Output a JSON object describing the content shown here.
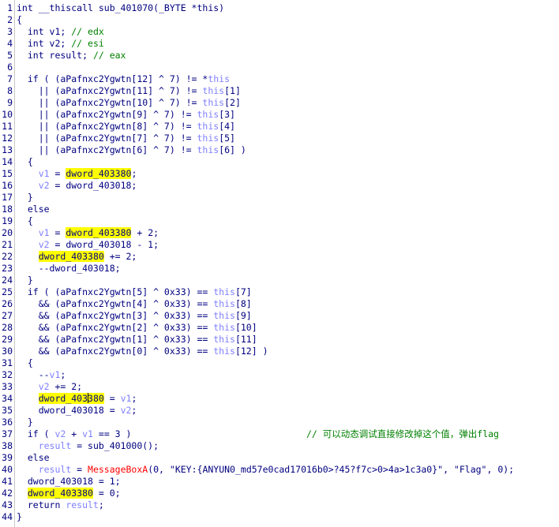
{
  "colors": {
    "background": "#ffffff",
    "text": "#000080",
    "comment": "#008000",
    "this_keyword": "#8080ff",
    "highlight": "#ffff00",
    "api_function": "#ff0000"
  },
  "line_numbers": [
    "1",
    "2",
    "3",
    "4",
    "5",
    "6",
    "7",
    "8",
    "9",
    "10",
    "11",
    "12",
    "13",
    "14",
    "15",
    "16",
    "17",
    "18",
    "19",
    "20",
    "21",
    "22",
    "23",
    "24",
    "25",
    "26",
    "27",
    "28",
    "29",
    "30",
    "31",
    "32",
    "33",
    "34",
    "35",
    "36",
    "37",
    "38",
    "39",
    "40",
    "41",
    "42",
    "43",
    "44"
  ],
  "code": {
    "l1": "int __thiscall sub_401070(_BYTE *this)",
    "l2": "{",
    "l3a": "  int v1; ",
    "l3b": "// edx",
    "l4a": "  int v2; ",
    "l4b": "// esi",
    "l5a": "  int result; ",
    "l5b": "// eax",
    "l6": "",
    "l7a": "  if ( (aPafnxc2Ygwtn[12] ^ 7) != *",
    "l7b": "this",
    "l8a": "    || (aPafnxc2Ygwtn[11] ^ 7) != ",
    "l8b": "this",
    "l8c": "[1]",
    "l9a": "    || (aPafnxc2Ygwtn[10] ^ 7) != ",
    "l9b": "this",
    "l9c": "[2]",
    "l10a": "    || (aPafnxc2Ygwtn[9] ^ 7) != ",
    "l10b": "this",
    "l10c": "[3]",
    "l11a": "    || (aPafnxc2Ygwtn[8] ^ 7) != ",
    "l11b": "this",
    "l11c": "[4]",
    "l12a": "    || (aPafnxc2Ygwtn[7] ^ 7) != ",
    "l12b": "this",
    "l12c": "[5]",
    "l13a": "    || (aPafnxc2Ygwtn[6] ^ 7) != ",
    "l13b": "this",
    "l13c": "[6] )",
    "l14": "  {",
    "l15a": "    ",
    "l15b": "v1",
    "l15c": " = ",
    "l15d": "dword_403380",
    "l15e": ";",
    "l16a": "    ",
    "l16b": "v2",
    "l16c": " = dword_403018;",
    "l17": "  }",
    "l18": "  else",
    "l19": "  {",
    "l20a": "    ",
    "l20b": "v1",
    "l20c": " = ",
    "l20d": "dword_403380",
    "l20e": " + 2;",
    "l21a": "    ",
    "l21b": "v2",
    "l21c": " = dword_403018 - 1;",
    "l22a": "    ",
    "l22b": "dword_403380",
    "l22c": " += 2;",
    "l23": "    --dword_403018;",
    "l24": "  }",
    "l25a": "  if ( (aPafnxc2Ygwtn[5] ^ 0x33) == ",
    "l25b": "this",
    "l25c": "[7]",
    "l26a": "    && (aPafnxc2Ygwtn[4] ^ 0x33) == ",
    "l26b": "this",
    "l26c": "[8]",
    "l27a": "    && (aPafnxc2Ygwtn[3] ^ 0x33) == ",
    "l27b": "this",
    "l27c": "[9]",
    "l28a": "    && (aPafnxc2Ygwtn[2] ^ 0x33) == ",
    "l28b": "this",
    "l28c": "[10]",
    "l29a": "    && (aPafnxc2Ygwtn[1] ^ 0x33) == ",
    "l29b": "this",
    "l29c": "[11]",
    "l30a": "    && (aPafnxc2Ygwtn[0] ^ 0x33) == ",
    "l30b": "this",
    "l30c": "[12] )",
    "l31": "  {",
    "l32a": "    --",
    "l32b": "v1",
    "l32c": ";",
    "l33a": "    ",
    "l33b": "v2",
    "l33c": " += 2;",
    "l34a": "    ",
    "l34b1": "dword_403",
    "l34b2": "380",
    "l34c": " = ",
    "l34d": "v1",
    "l34e": ";",
    "l35a": "    dword_403018 = ",
    "l35b": "v2",
    "l35c": ";",
    "l36": "  }",
    "l37a": "  if ( ",
    "l37b": "v2",
    "l37c": " + ",
    "l37d": "v1",
    "l37e": " == 3 )                                ",
    "l37f": "// 可以动态调试直接修改掉这个值，弹出flag",
    "l38a": "    ",
    "l38b": "result",
    "l38c": " = sub_401000();",
    "l39": "  else",
    "l40a": "    ",
    "l40b": "result",
    "l40c": " = ",
    "l40d": "MessageBoxA",
    "l40e": "(0, \"KEY:{ANYUN0_md57e0cad17016b0>?45?f7c>0>4a>1c3a0}\", \"Flag\", 0);",
    "l41": "  dword_403018 = 1;",
    "l42a": "  ",
    "l42b": "dword_403380",
    "l42c": " = 0;",
    "l43a": "  return ",
    "l43b": "result",
    "l43c": ";",
    "l44": "}"
  }
}
